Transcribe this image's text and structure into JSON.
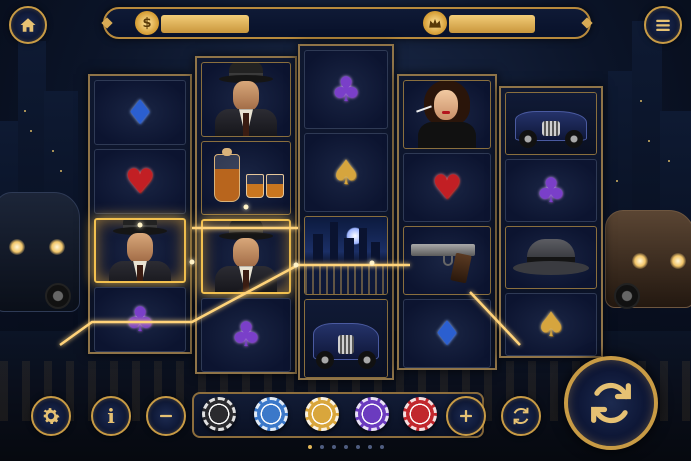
{
  "topbar": {
    "balance_icon": "dollar-coin-icon",
    "balance_coin_symbol": "$",
    "balance_value": "",
    "win_icon": "crown-icon",
    "win_value": ""
  },
  "buttons": {
    "home": "home-icon",
    "menu": "hamburger-menu-icon",
    "settings": "gear-icon",
    "info": "info-icon",
    "info_glyph": "i",
    "bet_decrease": "minus-icon",
    "bet_increase": "plus-icon",
    "autoplay": "autoplay-icon",
    "spin": "spin-icon"
  },
  "chips": [
    {
      "name": "chip-black",
      "color": "#2a2a2e"
    },
    {
      "name": "chip-blue",
      "color": "#3b78c9"
    },
    {
      "name": "chip-gold",
      "color": "#d9a63c"
    },
    {
      "name": "chip-purple",
      "color": "#6b3bbf"
    },
    {
      "name": "chip-red",
      "color": "#c1272d"
    }
  ],
  "reels": [
    {
      "symbols": [
        "diamond",
        "heart",
        "gangster",
        "club"
      ],
      "winning": [
        false,
        false,
        true,
        false
      ]
    },
    {
      "symbols": [
        "gangster",
        "whisky",
        "gangster",
        "club"
      ],
      "winning": [
        false,
        false,
        true,
        false
      ]
    },
    {
      "symbols": [
        "club",
        "spade",
        "city",
        "car"
      ],
      "winning": [
        false,
        false,
        false,
        false
      ]
    },
    {
      "symbols": [
        "lady",
        "heart",
        "gun",
        "diamond"
      ],
      "winning": [
        false,
        false,
        false,
        false
      ]
    },
    {
      "symbols": [
        "car",
        "club",
        "fedora",
        "spade"
      ],
      "winning": [
        false,
        false,
        false,
        false
      ]
    }
  ],
  "page_dots": {
    "count": 7,
    "active": 0
  },
  "colors": {
    "accent_gold": "#c89b45",
    "win_glow": "#f2c04f",
    "panel": "#0a1124"
  }
}
